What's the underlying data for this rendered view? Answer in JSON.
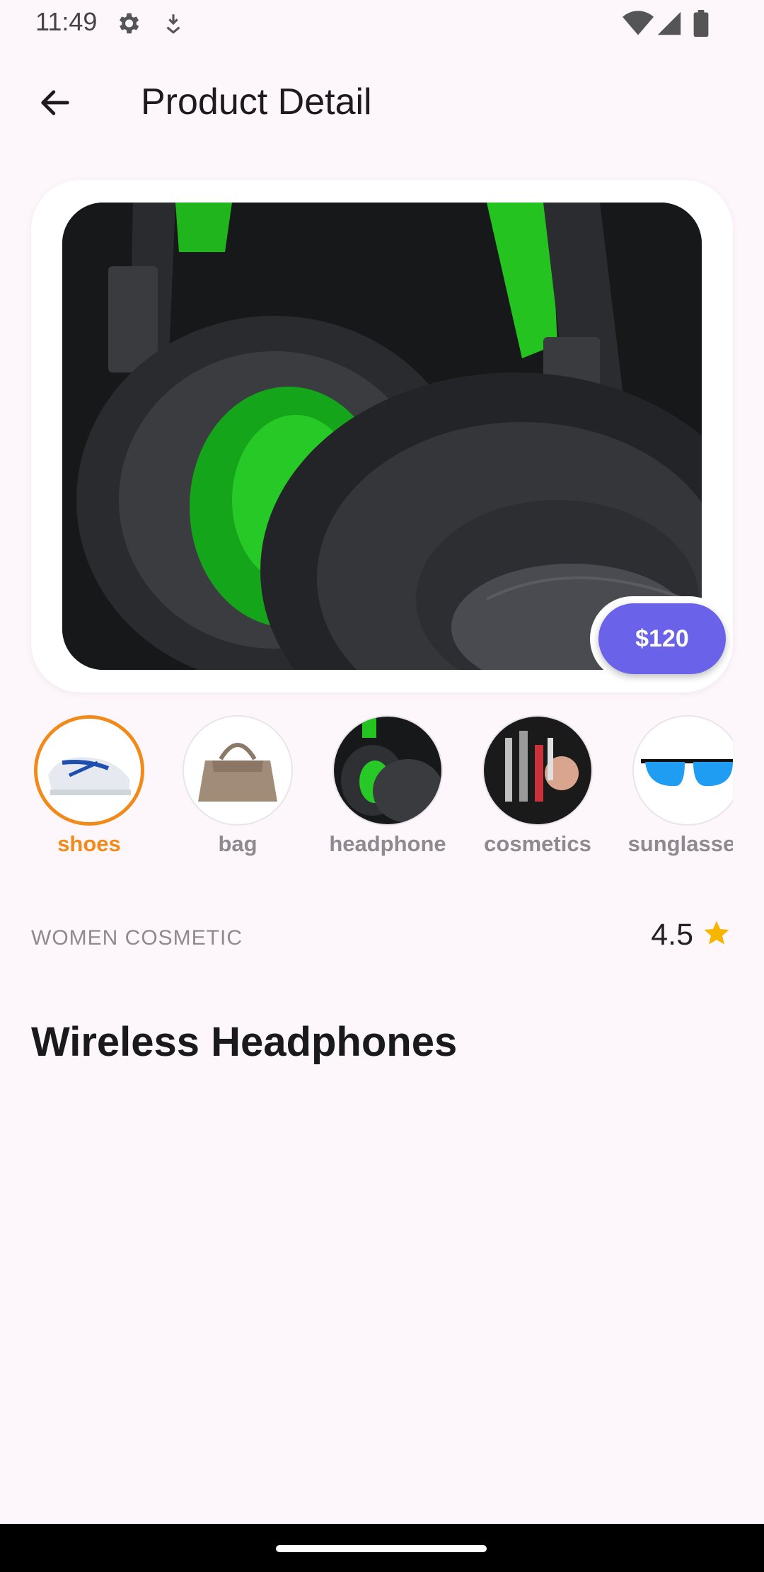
{
  "status_bar": {
    "time": "11:49"
  },
  "app_bar": {
    "title": "Product Detail"
  },
  "product": {
    "price": "$120",
    "category": "WOMEN COSMETIC",
    "rating": "4.5",
    "name": "Wireless Headphones"
  },
  "categories": [
    {
      "label": "shoes",
      "selected": true
    },
    {
      "label": "bag",
      "selected": false
    },
    {
      "label": "headphone",
      "selected": false
    },
    {
      "label": "cosmetics",
      "selected": false
    },
    {
      "label": "sunglasses",
      "selected": false
    }
  ],
  "colors": {
    "accent": "#f28a1a",
    "price_button": "#6a62e8",
    "star": "#f7b500",
    "background": "#fdf6fb"
  },
  "icons": [
    "settings-icon",
    "download-icon",
    "wifi-icon",
    "signal-icon",
    "battery-icon",
    "back-arrow-icon",
    "star-icon"
  ]
}
